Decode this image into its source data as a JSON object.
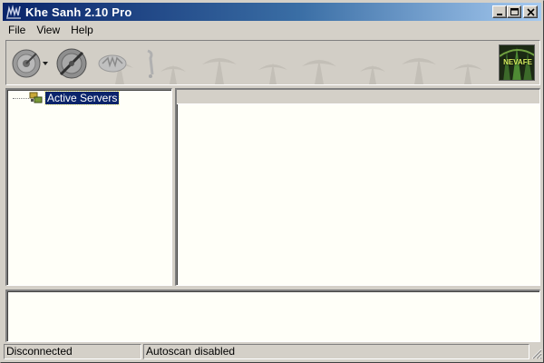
{
  "window": {
    "title": "Khe Sanh 2.10 Pro",
    "titlebar_color": "#0a246a"
  },
  "title_buttons": {
    "minimize_icon": "minimize-icon",
    "maximize_icon": "maximize-icon",
    "close_icon": "close-icon"
  },
  "menu": {
    "items": [
      {
        "label": "File"
      },
      {
        "label": "View"
      },
      {
        "label": "Help"
      }
    ]
  },
  "toolbar": {
    "buttons": [
      {
        "icon": "connect-dropdown-icon"
      },
      {
        "icon": "scan-icon"
      },
      {
        "icon": "server-icon"
      },
      {
        "icon": "disconnect-icon"
      }
    ],
    "logo_text": "NEVAFE"
  },
  "tree": {
    "root_label": "Active Servers",
    "selection_color": "#0a246a"
  },
  "status": {
    "connection": "Disconnected",
    "autoscan": "Autoscan disabled"
  }
}
